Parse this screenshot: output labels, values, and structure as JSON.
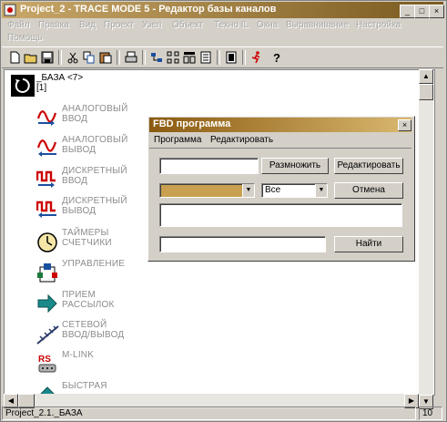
{
  "window": {
    "title": "Project_2 - TRACE MODE 5 - Редактор базы каналов",
    "controls": {
      "minimize": "_",
      "maximize": "□",
      "close": "×"
    }
  },
  "menu": [
    "Файл",
    "Правка",
    "Вид",
    "Проект",
    "Узел",
    "Объект",
    "Техно IL",
    "Окна",
    "Выравнивание",
    "Настройка",
    "Помощь"
  ],
  "toolbar": [
    "new-file-icon",
    "open-folder-icon",
    "save-icon",
    "cut-icon",
    "copy-icon",
    "paste-icon",
    "print-icon",
    "node-icon",
    "grid-icon",
    "layout-icon",
    "list-icon",
    "book-icon",
    "runner-icon",
    "help-icon"
  ],
  "tree": {
    "root_label": "_БАЗА <7>",
    "root_sub": "[1]",
    "items": [
      {
        "label": "АНАЛОГОВЫЙ\nВВОД",
        "icon": "analog-input-icon"
      },
      {
        "label": "АНАЛОГОВЫЙ\nВЫВОД",
        "icon": "analog-output-icon"
      },
      {
        "label": "ДИСКРЕТНЫЙ\nВВОД",
        "icon": "discrete-input-icon"
      },
      {
        "label": "ДИСКРЕТНЫЙ\nВЫВОД",
        "icon": "discrete-output-icon"
      },
      {
        "label": "ТАЙМЕРЫ\nСЧЕТЧИКИ",
        "icon": "clock-icon"
      },
      {
        "label": "УПРАВЛЕНИЕ",
        "icon": "control-icon"
      },
      {
        "label": "ПРИЕМ\nРАССЫЛОК",
        "icon": "arrow-right-icon"
      },
      {
        "label": "СЕТЕВОЙ\nВВОД/ВЫВОД",
        "icon": "network-icon"
      },
      {
        "label": "M-LINK",
        "icon": "rs-port-icon"
      },
      {
        "label": "БЫСТРАЯ",
        "icon": "fast-icon"
      }
    ]
  },
  "status": {
    "left": "Project_2.1._БАЗА",
    "right": "10"
  },
  "dialog": {
    "title": "FBD программа",
    "close": "×",
    "menu": [
      "Программа",
      "Редактировать"
    ],
    "buttons": {
      "multiply": "Размножить",
      "edit": "Редактировать",
      "cancel": "Отмена",
      "find": "Найти"
    },
    "select_all": "Все"
  },
  "colors": {
    "title_gradient_start": "#c9a86a",
    "dialog_title_start": "#8b5a10",
    "accent_red": "#cc0000",
    "accent_blue": "#1a4fa0"
  }
}
